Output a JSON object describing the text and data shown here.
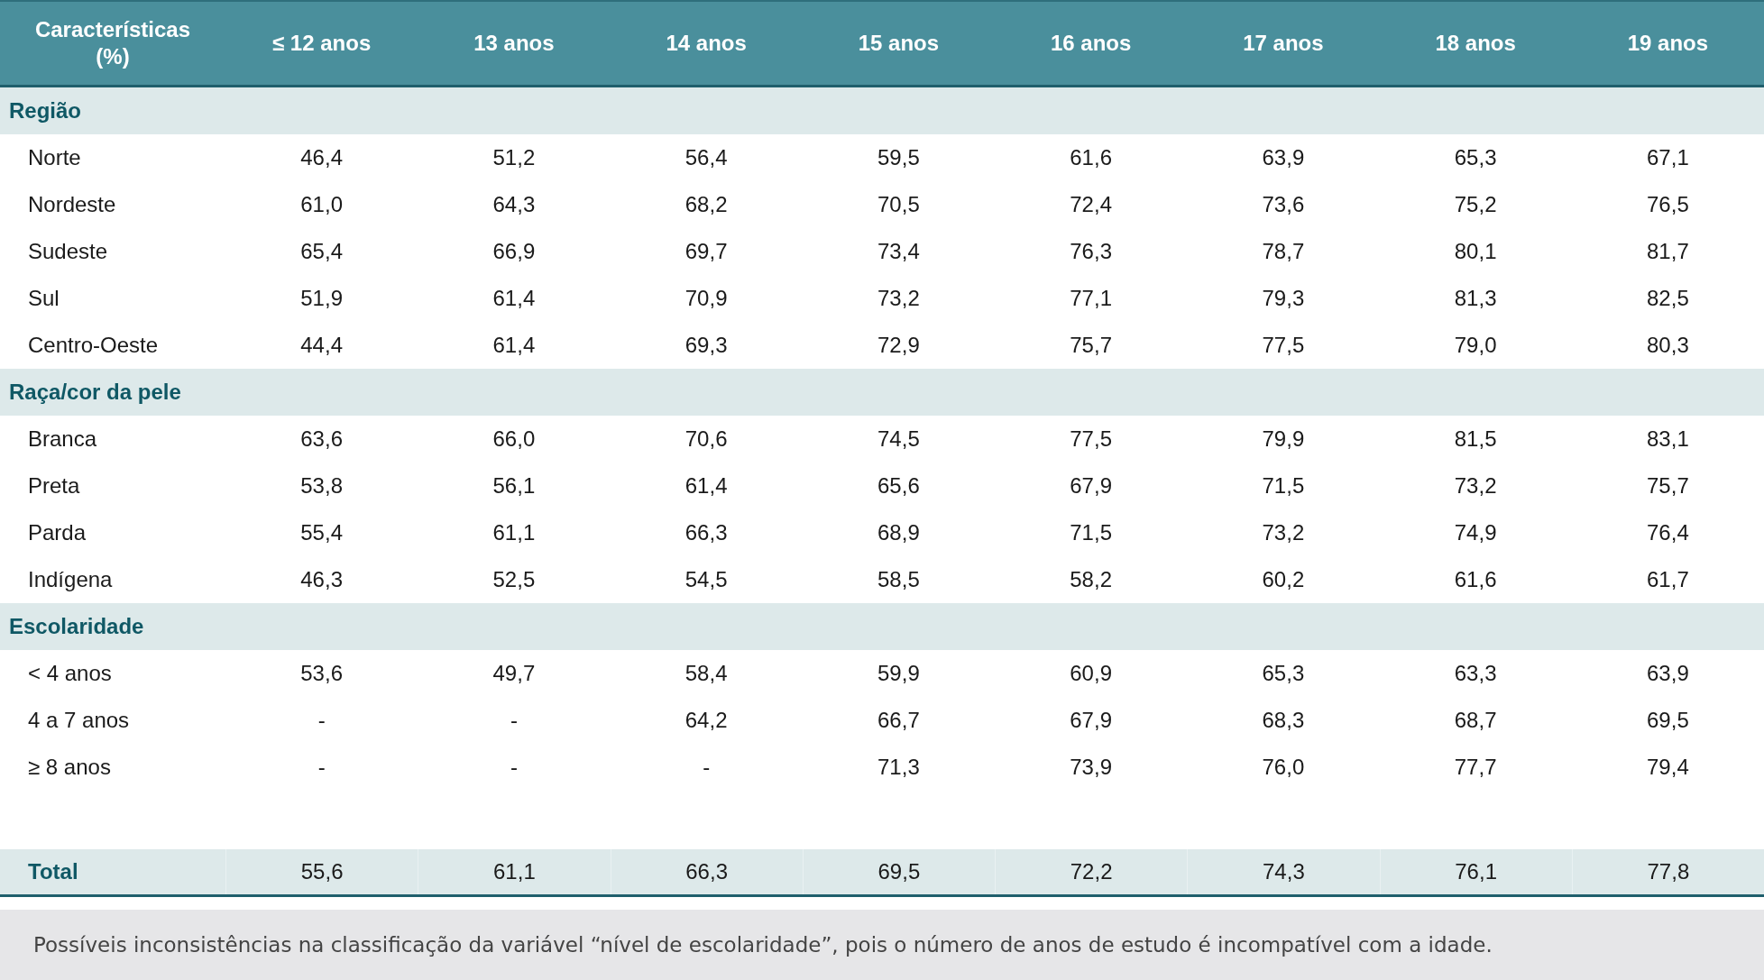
{
  "table": {
    "columns": [
      "Características (%)",
      "≤ 12 anos",
      "13 anos",
      "14 anos",
      "15 anos",
      "16 anos",
      "17 anos",
      "18 anos",
      "19 anos"
    ],
    "sections": [
      {
        "title": "Região",
        "rows": [
          {
            "label": "Norte",
            "values": [
              "46,4",
              "51,2",
              "56,4",
              "59,5",
              "61,6",
              "63,9",
              "65,3",
              "67,1"
            ]
          },
          {
            "label": "Nordeste",
            "values": [
              "61,0",
              "64,3",
              "68,2",
              "70,5",
              "72,4",
              "73,6",
              "75,2",
              "76,5"
            ]
          },
          {
            "label": "Sudeste",
            "values": [
              "65,4",
              "66,9",
              "69,7",
              "73,4",
              "76,3",
              "78,7",
              "80,1",
              "81,7"
            ]
          },
          {
            "label": "Sul",
            "values": [
              "51,9",
              "61,4",
              "70,9",
              "73,2",
              "77,1",
              "79,3",
              "81,3",
              "82,5"
            ]
          },
          {
            "label": "Centro-Oeste",
            "values": [
              "44,4",
              "61,4",
              "69,3",
              "72,9",
              "75,7",
              "77,5",
              "79,0",
              "80,3"
            ]
          }
        ]
      },
      {
        "title": "Raça/cor da pele",
        "rows": [
          {
            "label": "Branca",
            "values": [
              "63,6",
              "66,0",
              "70,6",
              "74,5",
              "77,5",
              "79,9",
              "81,5",
              "83,1"
            ]
          },
          {
            "label": "Preta",
            "values": [
              "53,8",
              "56,1",
              "61,4",
              "65,6",
              "67,9",
              "71,5",
              "73,2",
              "75,7"
            ]
          },
          {
            "label": "Parda",
            "values": [
              "55,4",
              "61,1",
              "66,3",
              "68,9",
              "71,5",
              "73,2",
              "74,9",
              "76,4"
            ]
          },
          {
            "label": "Indígena",
            "values": [
              "46,3",
              "52,5",
              "54,5",
              "58,5",
              "58,2",
              "60,2",
              "61,6",
              "61,7"
            ]
          }
        ]
      },
      {
        "title": "Escolaridade",
        "rows": [
          {
            "label": "< 4 anos",
            "values": [
              "53,6",
              "49,7",
              "58,4",
              "59,9",
              "60,9",
              "65,3",
              "63,3",
              "63,9"
            ]
          },
          {
            "label": "4 a 7 anos",
            "values": [
              "-",
              "-",
              "64,2",
              "66,7",
              "67,9",
              "68,3",
              "68,7",
              "69,5"
            ]
          },
          {
            "label": "≥ 8 anos",
            "values": [
              "-",
              "-",
              "-",
              "71,3",
              "73,9",
              "76,0",
              "77,7",
              "79,4"
            ]
          }
        ]
      }
    ],
    "total": {
      "label": "Total",
      "values": [
        "55,6",
        "61,1",
        "66,3",
        "69,5",
        "72,2",
        "74,3",
        "76,1",
        "77,8"
      ]
    }
  },
  "footnote": "Possíveis inconsistências na classificação da variável “nível de escolaridade”, pois o número de anos de estudo é incompatível com a idade."
}
